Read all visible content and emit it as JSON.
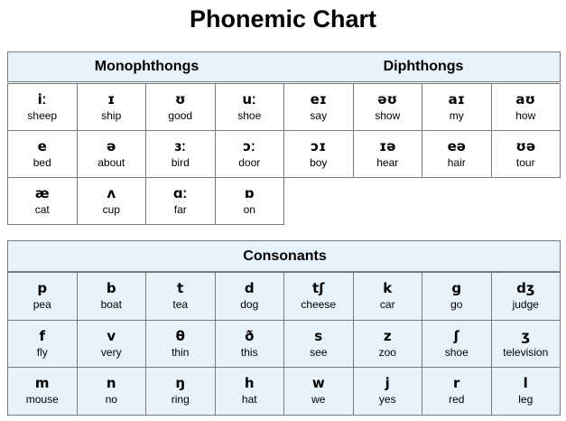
{
  "title": "Phonemic Chart",
  "sections": {
    "vowels": {
      "headers": [
        "Monophthongs",
        "Diphthongs"
      ],
      "monophthongs": [
        [
          {
            "sym": "iː",
            "word": "sheep"
          },
          {
            "sym": "ɪ",
            "word": "ship"
          },
          {
            "sym": "ʊ",
            "word": "good"
          },
          {
            "sym": "uː",
            "word": "shoe"
          }
        ],
        [
          {
            "sym": "e",
            "word": "bed"
          },
          {
            "sym": "ə",
            "word": "about"
          },
          {
            "sym": "ɜː",
            "word": "bird"
          },
          {
            "sym": "ɔː",
            "word": "door"
          }
        ],
        [
          {
            "sym": "æ",
            "word": "cat"
          },
          {
            "sym": "ʌ",
            "word": "cup"
          },
          {
            "sym": "ɑː",
            "word": "far"
          },
          {
            "sym": "ɒ",
            "word": "on"
          }
        ]
      ],
      "diphthongs": [
        [
          {
            "sym": "eɪ",
            "word": "say"
          },
          {
            "sym": "əʊ",
            "word": "show"
          },
          {
            "sym": "aɪ",
            "word": "my"
          },
          {
            "sym": "aʊ",
            "word": "how"
          }
        ],
        [
          {
            "sym": "ɔɪ",
            "word": "boy"
          },
          {
            "sym": "ɪə",
            "word": "hear"
          },
          {
            "sym": "eə",
            "word": "hair"
          },
          {
            "sym": "ʊə",
            "word": "tour"
          }
        ]
      ]
    },
    "consonants": {
      "header": "Consonants",
      "rows": [
        [
          {
            "sym": "p",
            "word": "pea"
          },
          {
            "sym": "b",
            "word": "boat"
          },
          {
            "sym": "t",
            "word": "tea"
          },
          {
            "sym": "d",
            "word": "dog"
          },
          {
            "sym": "tʃ",
            "word": "cheese"
          },
          {
            "sym": "k",
            "word": "car"
          },
          {
            "sym": "g",
            "word": "go"
          },
          {
            "sym": "dʒ",
            "word": "judge"
          }
        ],
        [
          {
            "sym": "f",
            "word": "fly"
          },
          {
            "sym": "v",
            "word": "very"
          },
          {
            "sym": "θ",
            "word": "thin"
          },
          {
            "sym": "ð",
            "word": "this"
          },
          {
            "sym": "s",
            "word": "see"
          },
          {
            "sym": "z",
            "word": "zoo"
          },
          {
            "sym": "ʃ",
            "word": "shoe"
          },
          {
            "sym": "ʒ",
            "word": "television"
          }
        ],
        [
          {
            "sym": "m",
            "word": "mouse"
          },
          {
            "sym": "n",
            "word": "no"
          },
          {
            "sym": "ŋ",
            "word": "ring"
          },
          {
            "sym": "h",
            "word": "hat"
          },
          {
            "sym": "w",
            "word": "we"
          },
          {
            "sym": "j",
            "word": "yes"
          },
          {
            "sym": "r",
            "word": "red"
          },
          {
            "sym": "l",
            "word": "leg"
          }
        ]
      ]
    }
  },
  "colors": {
    "header_bg": "#e7f2fb",
    "consonant_bg": "#e7f2fb",
    "border": "#7a7a7a"
  }
}
